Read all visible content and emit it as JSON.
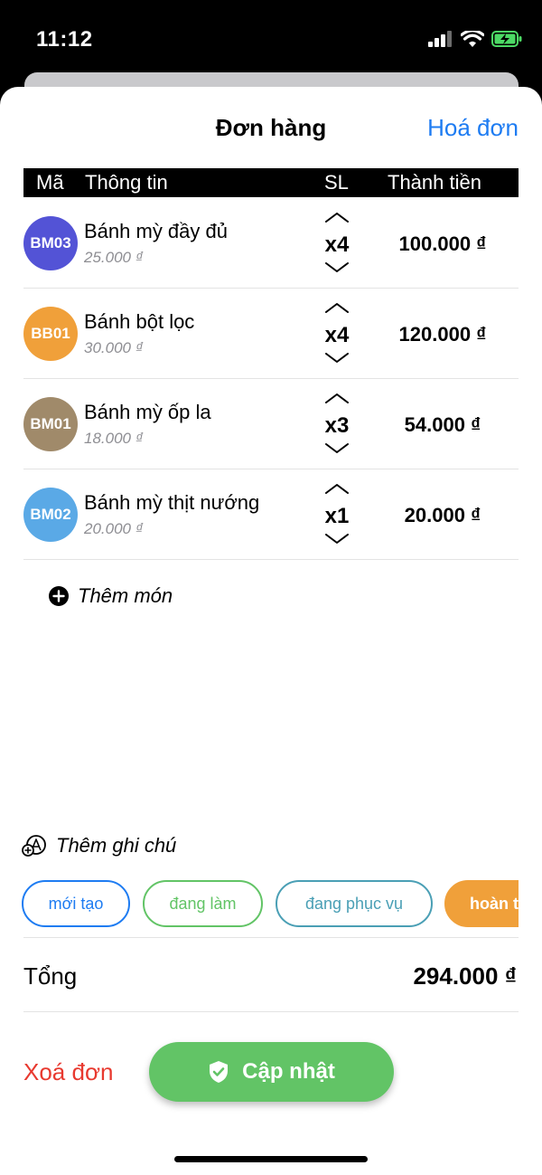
{
  "status_bar": {
    "time": "11:12",
    "icons": [
      "cellular-signal-icon",
      "wifi-icon",
      "battery-charging-icon"
    ],
    "battery_color": "#4cd964"
  },
  "header": {
    "title": "Đơn hàng",
    "action": "Hoá đơn",
    "action_color": "#1e7cf2"
  },
  "table": {
    "columns": [
      "Mã",
      "Thông tin",
      "SL",
      "Thành tiền"
    ],
    "rows": [
      {
        "code": "BM03",
        "code_color": "#5353d6",
        "name": "Bánh mỳ đầy đủ",
        "price": "25.000 ₫",
        "qty": "x4",
        "total": "100.000 ₫"
      },
      {
        "code": "BB01",
        "code_color": "#f0a03a",
        "name": "Bánh bột lọc",
        "price": "30.000 ₫",
        "qty": "x4",
        "total": "120.000 ₫"
      },
      {
        "code": "BM01",
        "code_color": "#a08a6a",
        "name": "Bánh mỳ ốp la",
        "price": "18.000 ₫",
        "qty": "x3",
        "total": "54.000 ₫"
      },
      {
        "code": "BM02",
        "code_color": "#5aa9e6",
        "name": "Bánh mỳ thịt nướng",
        "price": "20.000 ₫",
        "qty": "x1",
        "total": "20.000 ₫"
      }
    ]
  },
  "add_item_label": "Thêm món",
  "note_label": "Thêm ghi chú",
  "status_chips": [
    {
      "label": "mới tạo",
      "color": "#1e7cf2",
      "selected": false
    },
    {
      "label": "đang làm",
      "color": "#62c466",
      "selected": false
    },
    {
      "label": "đang phục vụ",
      "color": "#4a9fb5",
      "selected": false
    },
    {
      "label": "hoàn thành",
      "color": "#f0a03a",
      "selected": true
    }
  ],
  "summary": {
    "label": "Tổng",
    "value": "294.000 ₫"
  },
  "actions": {
    "delete_label": "Xoá đơn",
    "delete_color": "#e8392f",
    "update_label": "Cập nhật",
    "update_color": "#62c466"
  }
}
